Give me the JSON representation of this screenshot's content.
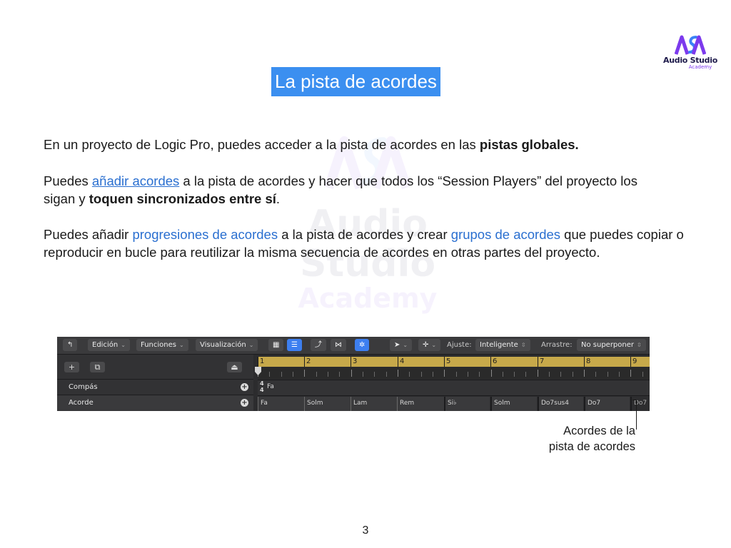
{
  "logo": {
    "text": "Audio Studio",
    "sub": "Academy",
    "colors": {
      "purple": "#7c3aed",
      "blue": "#3b82f6",
      "navy": "#1e1b4b"
    }
  },
  "title": "La pista de acordes",
  "p1": {
    "a": "En un proyecto de Logic Pro, puedes acceder a la pista de acordes en las ",
    "bold": "pistas globales."
  },
  "p2": {
    "a": "Puedes ",
    "link": "añadir acordes",
    "b": " a la pista de acordes y hacer que todos los “Session Players” del proyecto los sigan y ",
    "bold": "toquen sincronizados entre sí",
    "c": "."
  },
  "p3": {
    "a": "Puedes añadir ",
    "link1": "progresiones de acordes",
    "b": " a la pista de acordes y crear ",
    "link2": "grupos de acordes",
    "c": " que puedes copiar o reproducir en bucle para reutilizar la misma secuencia de acordes en otras partes del proyecto."
  },
  "logic": {
    "toolbar": {
      "edicion": "Edición",
      "funciones": "Funciones",
      "visualizacion": "Visualización",
      "ajuste_label": "Ajuste:",
      "ajuste_value": "Inteligente",
      "arrastre_label": "Arrastre:",
      "arrastre_value": "No superponer"
    },
    "add_btn": "+",
    "tracks": {
      "compas": "Compás",
      "acorde": "Acorde"
    },
    "bars": [
      "1",
      "2",
      "3",
      "4",
      "5",
      "6",
      "7",
      "8",
      "9"
    ],
    "time_sig_top": "4",
    "time_sig_bottom": "4",
    "key": "Fa",
    "chords": [
      "Fa",
      "Solm",
      "Lam",
      "Rem",
      "Si♭",
      "Solm",
      "Do7sus4",
      "Do7",
      "Do7"
    ]
  },
  "callout": {
    "line1": "Acordes de la",
    "line2": "pista de acordes"
  },
  "page_number": "3"
}
